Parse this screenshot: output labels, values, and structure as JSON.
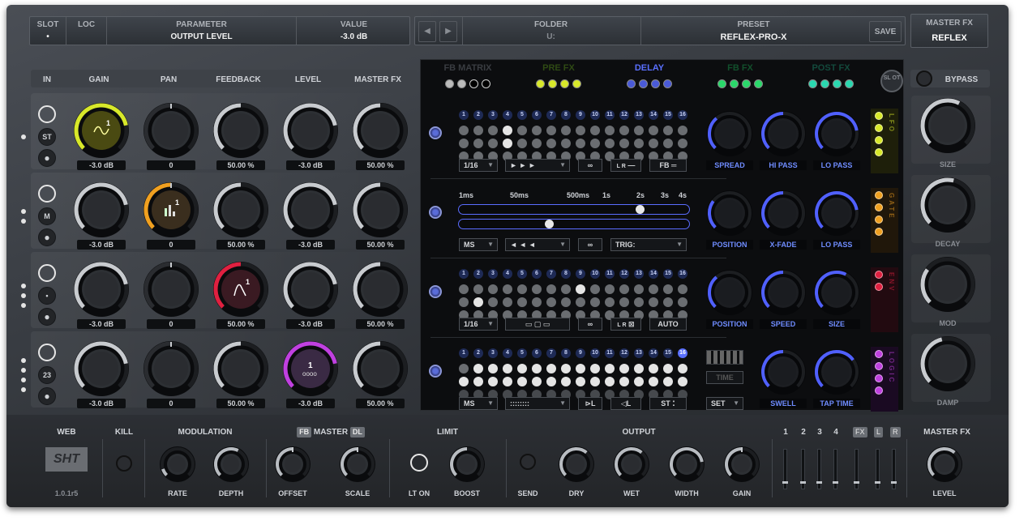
{
  "top": {
    "slot_label": "SLOT",
    "slot_value": "•",
    "loc_label": "LOC",
    "param_label": "PARAMETER",
    "param_value": "OUTPUT LEVEL",
    "value_label": "VALUE",
    "value_value": "-3.0 dB",
    "prev": "◀",
    "next": "▶",
    "folder_label": "FOLDER",
    "folder_value": "U:",
    "preset_label": "PRESET",
    "preset_value": "REFLEX-PRO-X",
    "save": "SAVE",
    "masterfx_label": "MASTER FX",
    "masterfx_value": "REFLEX"
  },
  "columns": [
    "IN",
    "GAIN",
    "PAN",
    "FEEDBACK",
    "LEVEL",
    "MASTER FX"
  ],
  "rows": [
    {
      "mode": "ST",
      "gain": "-3.0 dB",
      "pan": "0",
      "feedback": "50.00 %",
      "level": "-3.0 dB",
      "master": "50.00 %",
      "gain_v": 0.79,
      "pan_v": 0.5,
      "feedback_v": 0.5,
      "level_v": 0.79,
      "master_v": 0.5,
      "icon": "1"
    },
    {
      "mode": "M",
      "gain": "-3.0 dB",
      "pan": "0",
      "feedback": "50.00 %",
      "level": "-3.0 dB",
      "master": "50.00 %",
      "gain_v": 0.79,
      "pan_v": 0.5,
      "feedback_v": 0.5,
      "level_v": 0.79,
      "master_v": 0.5,
      "icon": "1"
    },
    {
      "mode": "•",
      "gain": "-3.0 dB",
      "pan": "0",
      "feedback": "50.00 %",
      "level": "-3.0 dB",
      "master": "50.00 %",
      "gain_v": 0.79,
      "pan_v": 0.5,
      "feedback_v": 0.5,
      "level_v": 0.79,
      "master_v": 0.5,
      "icon": "1"
    },
    {
      "mode": "23",
      "gain": "-3.0 dB",
      "pan": "0",
      "feedback": "50.00 %",
      "level": "-3.0 dB",
      "master": "50.00 %",
      "gain_v": 0.79,
      "pan_v": 0.5,
      "feedback_v": 0.5,
      "level_v": 0.79,
      "master_v": 0.5,
      "icon": "1"
    }
  ],
  "tabs": [
    {
      "label": "FB MATRIX",
      "color": "#3a3d42",
      "dots": [
        "#bbbbbb",
        "#bbbbbb",
        "#000000",
        "#000000"
      ]
    },
    {
      "label": "PRE FX",
      "color": "#2f4a14",
      "dots": [
        "#d8e82a",
        "#d8e82a",
        "#d8e82a",
        "#d8e82a"
      ]
    },
    {
      "label": "DELAY",
      "color": "#5a70ff",
      "dots": [
        "#4a5ad8",
        "#4a5ad8",
        "#4a5ad8",
        "#4a5ad8"
      ]
    },
    {
      "label": "FB FX",
      "color": "#12502c",
      "dots": [
        "#2ad86a",
        "#2ad86a",
        "#2ad86a",
        "#2ad86a"
      ]
    },
    {
      "label": "POST FX",
      "color": "#134a3c",
      "dots": [
        "#2ad8b0",
        "#2ad8b0",
        "#2ad8b0",
        "#2ad8b0"
      ]
    }
  ],
  "slot_button": "SL OT",
  "steps": [
    "1",
    "2",
    "3",
    "4",
    "5",
    "6",
    "7",
    "8",
    "9",
    "10",
    "11",
    "12",
    "13",
    "14",
    "15",
    "16"
  ],
  "sec1": {
    "sel1": "1/16",
    "sel2": "► ► ►",
    "fb": "FB",
    "lr": "L R",
    "k1": "SPREAD",
    "k2": "HI PASS",
    "k3": "LO PASS",
    "side": "LFO"
  },
  "sec2": {
    "t1": "1ms",
    "t2": "50ms",
    "t3": "500ms",
    "t4": "1s",
    "t5": "2s",
    "t6": "3s",
    "t7": "4s",
    "sel1": "MS",
    "sel2": "◄ ◄ ◄",
    "trig": "TRIG:",
    "k1": "POSITION",
    "k2": "X-FADE",
    "k3": "LO PASS",
    "side": "GATE",
    "slider1": 0.8,
    "slider2": 0.39
  },
  "sec3": {
    "sel1": "1/16",
    "auto": "AUTO",
    "lr": "L R",
    "k1": "POSITION",
    "k2": "SPEED",
    "k3": "SIZE",
    "side": "ENV"
  },
  "sec4": {
    "sel1": "MS",
    "sel2": "::::::::",
    "st": "ST",
    "time": "TIME",
    "set": "SET",
    "k1": "SWELL",
    "k2": "TAP TIME",
    "side": "LOGIC",
    "tl": "L",
    "tl2": "L"
  },
  "right": {
    "bypass": "BYPASS",
    "k1": "SIZE",
    "k2": "DECAY",
    "k3": "MOD",
    "k4": "DAMP"
  },
  "bottom": {
    "web": "WEB",
    "kill": "KILL",
    "modulation": "MODULATION",
    "fb": "FB",
    "master": "MASTER",
    "dl": "DL",
    "limit": "LIMIT",
    "output": "OUTPUT",
    "masterfx": "MASTER FX",
    "logo": "SHT",
    "version": "1.0.1r5",
    "rate": "RATE",
    "depth": "DEPTH",
    "offset": "OFFSET",
    "scale": "SCALE",
    "lton": "LT ON",
    "boost": "BOOST",
    "send": "SEND",
    "dry": "DRY",
    "wet": "WET",
    "width": "WIDTH",
    "gain": "GAIN",
    "level": "LEVEL",
    "ch": [
      "1",
      "2",
      "3",
      "4",
      "FX",
      "L",
      "R"
    ]
  },
  "colors": {
    "yellow": "#d8e82a",
    "orange": "#f0a020",
    "red": "#e02040",
    "purple": "#c040e0",
    "blue": "#4a5ad8"
  }
}
